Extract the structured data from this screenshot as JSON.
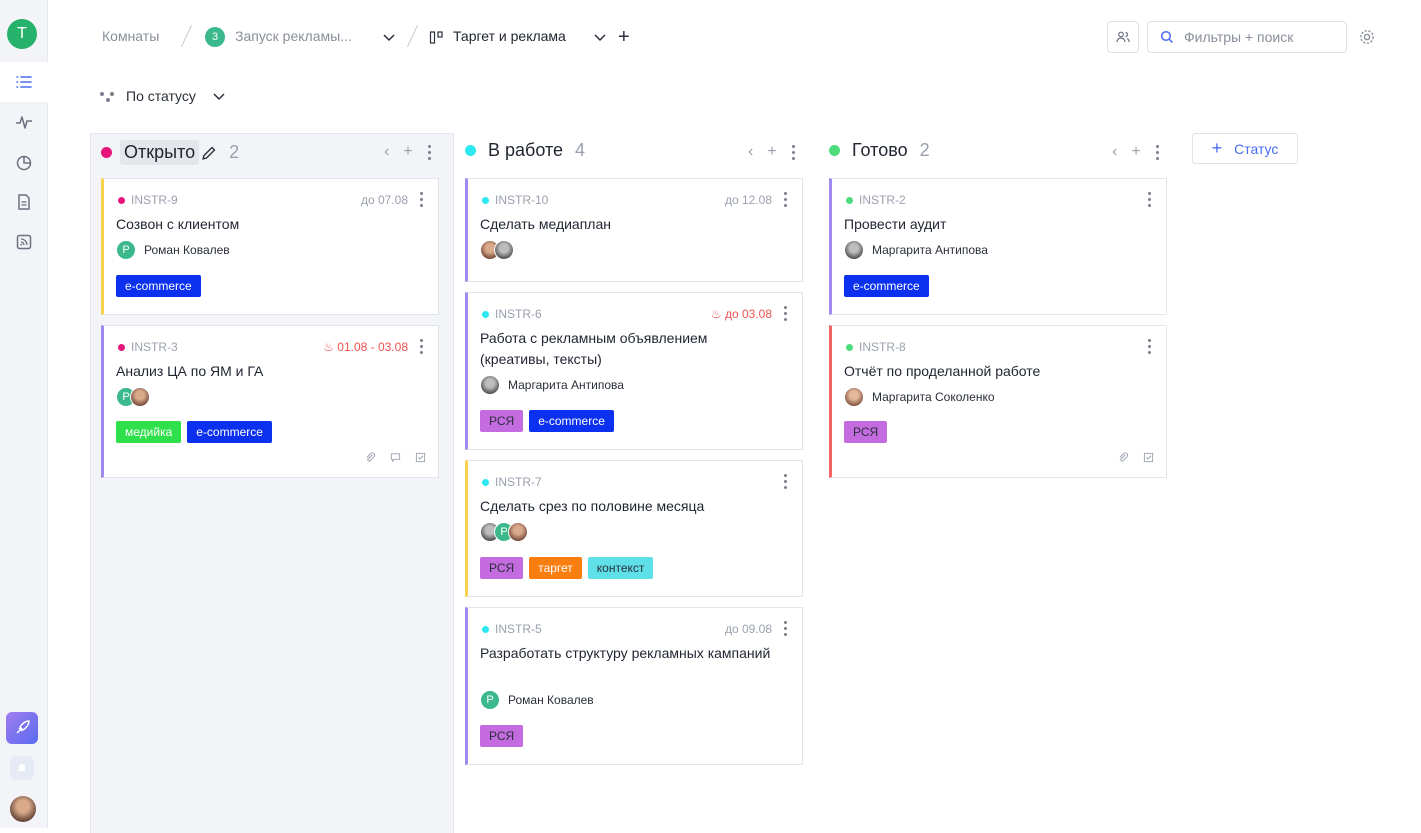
{
  "workspace": {
    "initial": "T"
  },
  "breadcrumbs": {
    "rooms": "Комнаты",
    "project_badge": "3",
    "project": "Запуск рекламы...",
    "board": "Таргет и реклама",
    "add": "+"
  },
  "search": {
    "placeholder": "Фильтры + поиск"
  },
  "groupby": {
    "label": "По статусу"
  },
  "add_status": {
    "label": "Статус"
  },
  "colors": {
    "accent": "#4a6cf0",
    "open": "#e6157a",
    "work": "#2de8f0",
    "done": "#4cdc7c"
  },
  "columns": [
    {
      "title": "Открыто",
      "count": "2"
    },
    {
      "title": "В работе",
      "count": "4"
    },
    {
      "title": "Готово",
      "count": "2"
    }
  ],
  "cards": {
    "instr9": {
      "id": "INSTR-9",
      "due": "до 07.08",
      "title": "Созвон с клиентом",
      "person": "Роман Ковалев",
      "avatar_initial": "Р",
      "tags": [
        "e-commerce"
      ]
    },
    "instr3": {
      "id": "INSTR-3",
      "due": "01.08 - 03.08",
      "title": "Анализ ЦА по ЯМ и ГА",
      "avatar_initial": "Р",
      "tags": [
        "медийка",
        "e-commerce"
      ]
    },
    "instr10": {
      "id": "INSTR-10",
      "due": "до 12.08",
      "title": "Сделать медиаплан"
    },
    "instr6": {
      "id": "INSTR-6",
      "due": "до 03.08",
      "title": "Работа с рекламным объявлением (креативы, тексты)",
      "person": "Маргарита Антипова",
      "tags": [
        "РСЯ",
        "e-commerce"
      ]
    },
    "instr7": {
      "id": "INSTR-7",
      "title": "Сделать срез по половине месяца",
      "avatar_initial": "Р",
      "tags": [
        "РСЯ",
        "таргет",
        "контекст"
      ]
    },
    "instr5": {
      "id": "INSTR-5",
      "due": "до 09.08",
      "title": "Разработать структуру рекламных кампаний",
      "person": "Роман Ковалев",
      "avatar_initial": "Р",
      "tags": [
        "РСЯ"
      ]
    },
    "instr2": {
      "id": "INSTR-2",
      "title": "Провести аудит",
      "person": "Маргарита Антипова",
      "tags": [
        "e-commerce"
      ]
    },
    "instr8": {
      "id": "INSTR-8",
      "title": "Отчёт по проделанной работе",
      "person": "Маргарита Соколенко",
      "tags": [
        "РСЯ"
      ]
    }
  }
}
